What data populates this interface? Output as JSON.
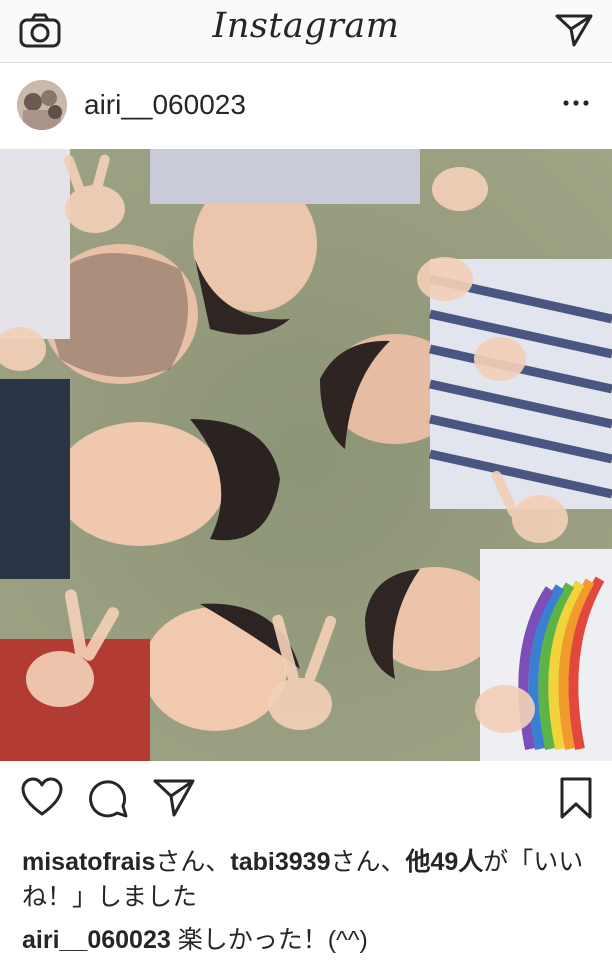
{
  "app": {
    "logo": "Instagram",
    "camera_icon": "camera-icon",
    "direct_icon": "paper-plane-icon"
  },
  "post": {
    "username": "airi__060023",
    "more_icon": "ellipsis-icon",
    "photo_icon": "photo"
  },
  "actions": {
    "like_icon": "heart-icon",
    "comment_icon": "comment-bubble-icon",
    "share_icon": "paper-plane-icon",
    "save_icon": "bookmark-icon"
  },
  "likes": {
    "user1": "misatofrais",
    "suffix1": "さん、",
    "user2": "tabi3939",
    "suffix2": "さん、",
    "others": "他49人",
    "end": "が「いいね！」しました"
  },
  "caption": {
    "username": "airi__060023",
    "text": " 楽しかった！(^^)"
  },
  "colors": {
    "text": "#262626",
    "border": "#dbdbdb",
    "topbar_bg": "#fafafa"
  }
}
